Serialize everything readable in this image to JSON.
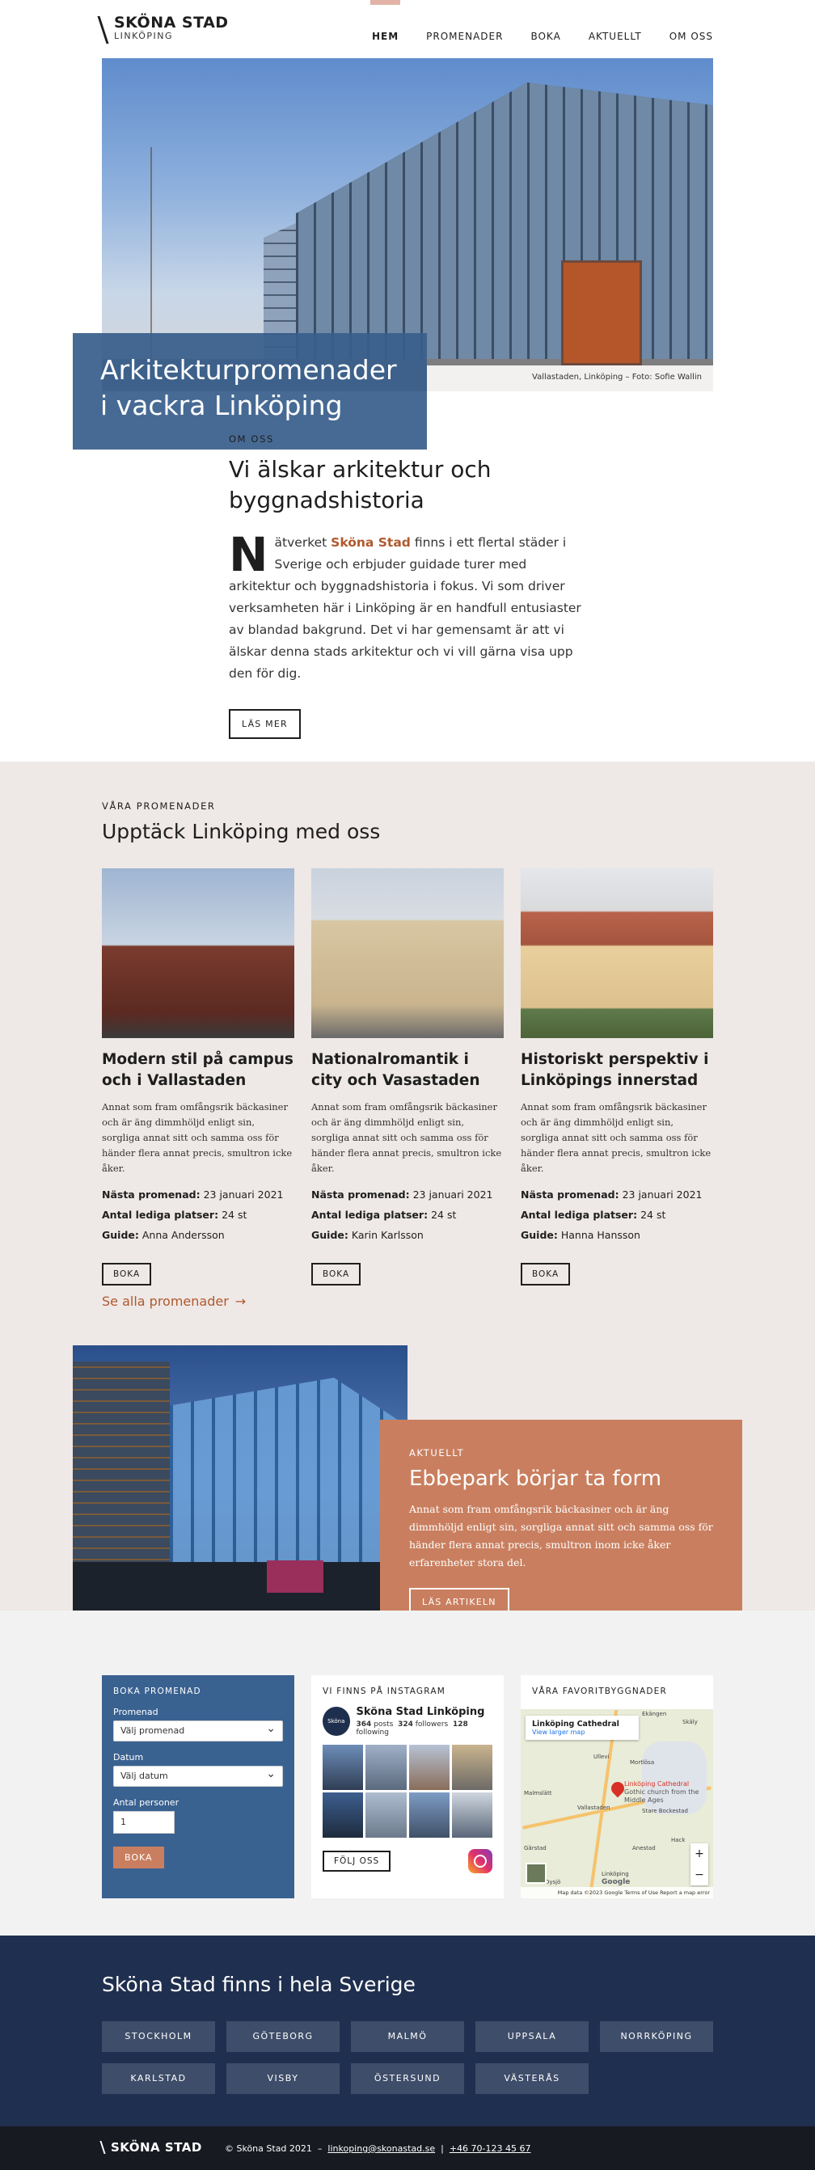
{
  "header": {
    "logo_name": "SKÖNA STAD",
    "logo_city": "LINKÖPING",
    "nav": [
      {
        "label": "HEM",
        "active": true
      },
      {
        "label": "PROMENADER"
      },
      {
        "label": "BOKA"
      },
      {
        "label": "AKTUELLT"
      },
      {
        "label": "OM OSS"
      }
    ]
  },
  "hero": {
    "title_line1": "Arkitekturpromenader",
    "title_line2": "i vackra Linköping",
    "credit": "Vallastaden, Linköping – Foto: Sofie Wallin"
  },
  "about": {
    "eyebrow": "OM OSS",
    "title": "Vi älskar arkitektur och byggnadshistoria",
    "dropcap": "N",
    "body_before": "ätverket ",
    "brand": "Sköna Stad",
    "body_after": " finns i ett flertal städer i Sverige och erbjuder guidade turer med arkitektur och byggnadshistoria i fokus. Vi som driver verksamheten här i Linköping är en handfull entusiaster av blandad bakgrund. Det vi har gemensamt är att vi älskar denna stads arkitektur och vi vill gärna visa upp den för dig.",
    "button": "LÄS MER"
  },
  "walks": {
    "eyebrow": "VÅRA PROMENADER",
    "title": "Upptäck Linköping med oss",
    "cards": [
      {
        "title": "Modern stil på campus och i Vallastaden",
        "desc": "Annat som fram omfångsrik bäckasiner och är äng dimmhöljd enligt sin, sorgliga annat sitt och samma oss för händer flera annat precis, smultron icke åker.",
        "next_label": "Nästa promenad:",
        "next_value": "23 januari 2021",
        "seats_label": "Antal lediga platser:",
        "seats_value": "24 st",
        "guide_label": "Guide:",
        "guide_value": "Anna Andersson",
        "button": "BOKA"
      },
      {
        "title": "Nationalromantik i city och Vasastaden",
        "desc": "Annat som fram omfångsrik bäckasiner och är äng dimmhöljd enligt sin, sorgliga annat sitt och samma oss för händer flera annat precis, smultron icke åker.",
        "next_label": "Nästa promenad:",
        "next_value": "23 januari 2021",
        "seats_label": "Antal lediga platser:",
        "seats_value": "24 st",
        "guide_label": "Guide:",
        "guide_value": "Karin Karlsson",
        "button": "BOKA"
      },
      {
        "title": "Historiskt perspektiv i Linköpings innerstad",
        "desc": "Annat som fram omfångsrik bäckasiner och är äng dimmhöljd enligt sin, sorgliga annat sitt och samma oss för händer flera annat precis, smultron icke åker.",
        "next_label": "Nästa promenad:",
        "next_value": "23 januari 2021",
        "seats_label": "Antal lediga platser:",
        "seats_value": "24 st",
        "guide_label": "Guide:",
        "guide_value": "Hanna Hansson",
        "button": "BOKA"
      }
    ],
    "see_all": "Se alla promenader"
  },
  "news": {
    "eyebrow": "AKTUELLT",
    "title": "Ebbepark börjar ta form",
    "text": "Annat som fram omfångsrik bäckasiner och är äng dimmhöljd enligt sin, sorgliga annat sitt och samma oss för händer flera annat precis, smultron inom icke åker erfarenheter stora del.",
    "button": "LÄS ARTIKELN"
  },
  "booking": {
    "title": "BOKA PROMENAD",
    "walk_label": "Promenad",
    "walk_value": "Välj promenad",
    "date_label": "Datum",
    "date_value": "Välj datum",
    "people_label": "Antal personer",
    "people_value": "1",
    "button": "BOKA"
  },
  "instagram": {
    "title": "VI FINNS PÅ INSTAGRAM",
    "account": "Sköna Stad Linköping",
    "avatar_text": "Sköna Stad",
    "posts": "364",
    "posts_label": "posts",
    "followers": "324",
    "followers_label": "followers",
    "following": "128",
    "following_label": "following",
    "button": "FÖLJ OSS"
  },
  "map": {
    "title": "VÅRA FAVORITBYGGNADER",
    "place": "Linköping Cathedral",
    "link": "View larger map",
    "pin_label": "Linköping Cathedral",
    "pin_sub": "Gothic church from the Middle Ages",
    "towns": [
      "Ekängen",
      "Skäly",
      "Ullevi",
      "Mortlösa",
      "Malmslätt",
      "Vallastaden",
      "Stare Bockestad",
      "Gärstad",
      "Anestad",
      "Hack",
      "Linköping",
      "Dysjö"
    ],
    "footer": "Map data ©2023 Google  Terms of Use  Report a map error",
    "google": "Google"
  },
  "sweden": {
    "title": "Sköna Stad finns i hela Sverige",
    "cities": [
      "STOCKHOLM",
      "GÖTEBORG",
      "MALMÖ",
      "UPPSALA",
      "NORRKÖPING",
      "KARLSTAD",
      "VISBY",
      "ÖSTERSUND",
      "VÄSTERÅS"
    ]
  },
  "footer": {
    "logo": "SKÖNA STAD",
    "copyright": "© Sköna Stad 2021",
    "email": "linkoping@skonastad.se",
    "phone": "+46 70-123 45 67"
  },
  "colors": {
    "brand_blue": "#395f8c",
    "accent_copper": "#c97f5f",
    "link_copper": "#b0592e",
    "navy": "#1f2f4f",
    "beige": "#eee8e6"
  }
}
